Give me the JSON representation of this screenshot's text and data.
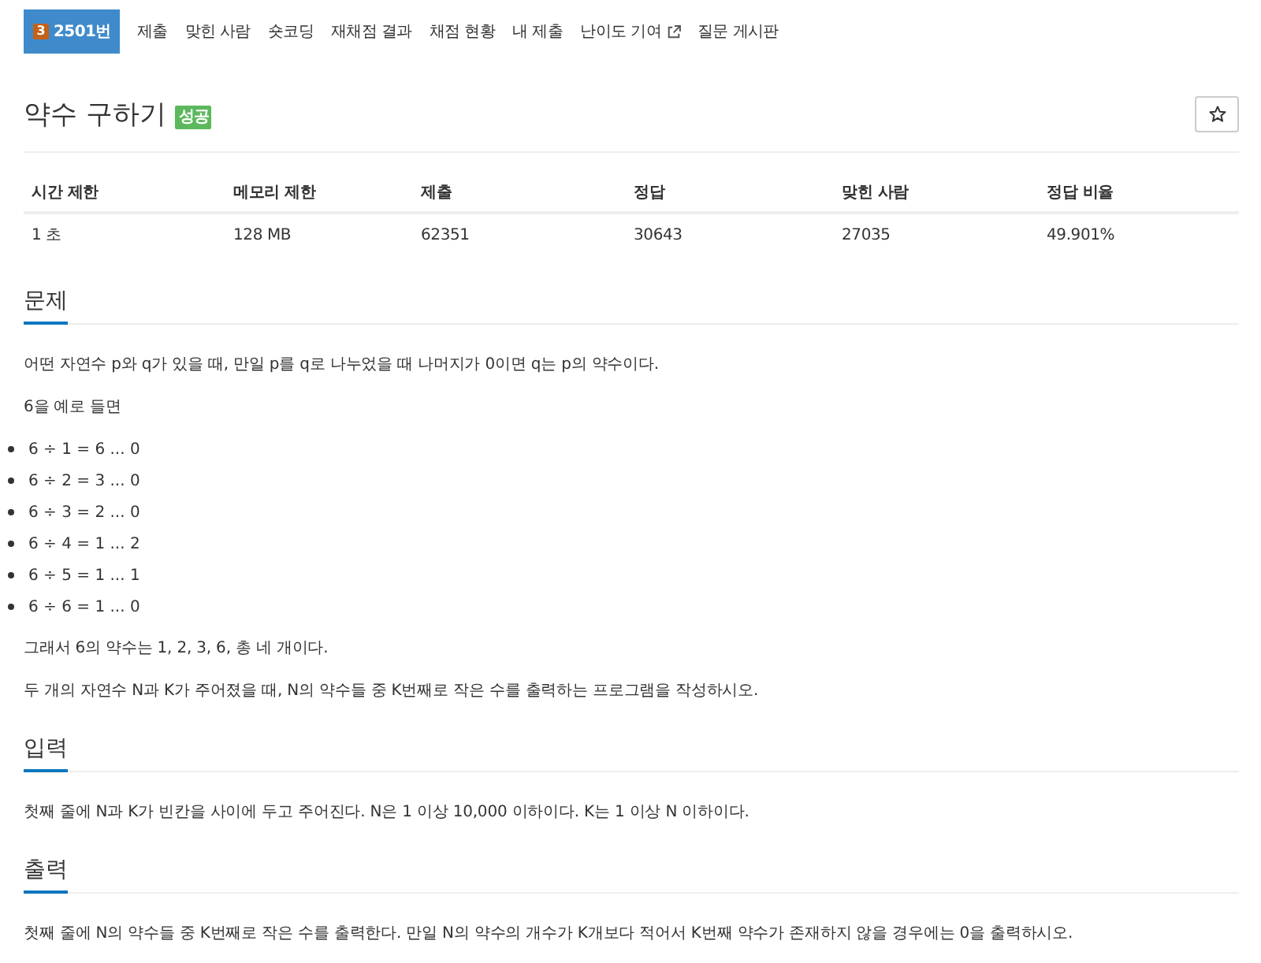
{
  "nav_tabs": [
    {
      "label": "2501번",
      "kind": "problem",
      "badge": "3",
      "selected": true
    },
    {
      "label": "제출",
      "kind": "link",
      "selected": false
    },
    {
      "label": "맞힌 사람",
      "kind": "link",
      "selected": false
    },
    {
      "label": "숏코딩",
      "kind": "link",
      "selected": false
    },
    {
      "label": "재채점 결과",
      "kind": "link",
      "selected": false
    },
    {
      "label": "채점 현황",
      "kind": "link",
      "selected": false
    },
    {
      "label": "내 제출",
      "kind": "link",
      "selected": false
    },
    {
      "label": "난이도 기여",
      "kind": "external",
      "selected": false
    },
    {
      "label": "질문 게시판",
      "kind": "link",
      "selected": false
    }
  ],
  "title": {
    "text": "약수 구하기",
    "status": "성공"
  },
  "info_table": {
    "columns": [
      "시간 제한",
      "메모리 제한",
      "제출",
      "정답",
      "맞힌 사람",
      "정답 비율"
    ],
    "rows": [
      [
        "1 초",
        "128 MB",
        "62351",
        "30643",
        "27035",
        "49.901%"
      ]
    ]
  },
  "sections": [
    {
      "heading": "문제",
      "blocks": [
        {
          "kind": "paragraph",
          "text": "어떤 자연수 p와 q가 있을 때, 만일 p를 q로 나누었을 때 나머지가 0이면 q는 p의 약수이다."
        },
        {
          "kind": "paragraph",
          "text": "6을 예로 들면"
        },
        {
          "kind": "list",
          "items": [
            "6 ÷ 1 = 6 ... 0",
            "6 ÷ 2 = 3 ... 0",
            "6 ÷ 3 = 2 ... 0",
            "6 ÷ 4 = 1 ... 2",
            "6 ÷ 5 = 1 ... 1",
            "6 ÷ 6 = 1 ... 0"
          ]
        },
        {
          "kind": "paragraph",
          "text": "그래서 6의 약수는 1, 2, 3, 6, 총 네 개이다."
        },
        {
          "kind": "paragraph",
          "text": "두 개의 자연수 N과 K가 주어졌을 때, N의 약수들 중 K번째로 작은 수를 출력하는 프로그램을 작성하시오."
        }
      ]
    },
    {
      "heading": "입력",
      "blocks": [
        {
          "kind": "paragraph",
          "text": "첫째 줄에 N과 K가 빈칸을 사이에 두고 주어진다. N은 1 이상 10,000 이하이다. K는 1 이상 N 이하이다."
        }
      ]
    },
    {
      "heading": "출력",
      "blocks": [
        {
          "kind": "paragraph",
          "text": "첫째 줄에 N의 약수들 중 K번째로 작은 수를 출력한다. 만일 N의 약수의 개수가 K개보다 적어서 K번째 약수가 존재하지 않을 경우에는 0을 출력하시오."
        }
      ]
    }
  ]
}
